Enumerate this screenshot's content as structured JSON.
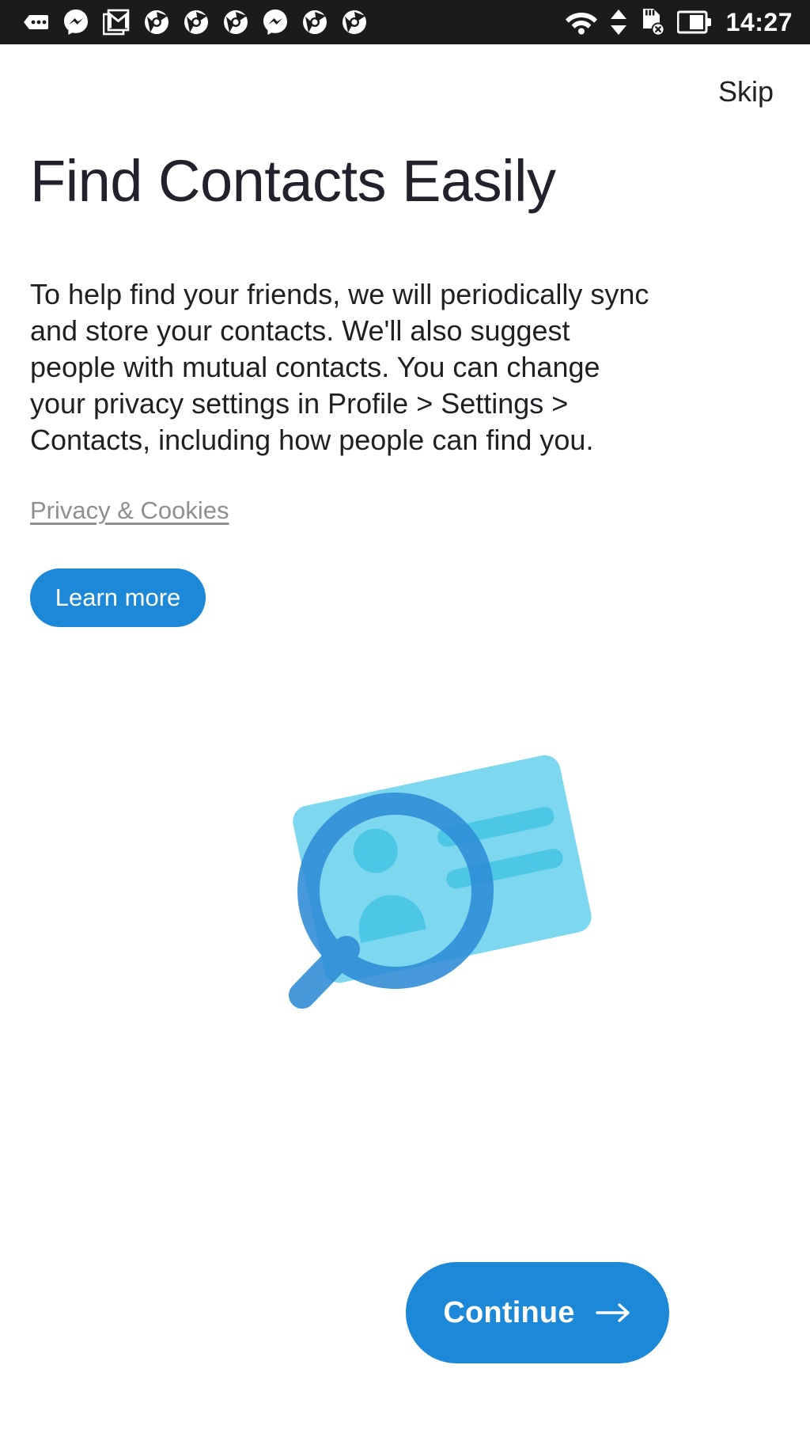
{
  "statusbar": {
    "time": "14:27",
    "left_icons": [
      {
        "name": "messages-more-icon",
        "label": "messages"
      },
      {
        "name": "messenger-icon",
        "label": "messenger"
      },
      {
        "name": "gmail-stacked-icon",
        "label": "gmail"
      },
      {
        "name": "chrome-icon",
        "label": "chrome"
      },
      {
        "name": "chrome-icon",
        "label": "chrome"
      },
      {
        "name": "chrome-icon",
        "label": "chrome"
      },
      {
        "name": "messenger-icon",
        "label": "messenger"
      },
      {
        "name": "chrome-icon",
        "label": "chrome"
      },
      {
        "name": "chrome-icon",
        "label": "chrome"
      }
    ],
    "right_icons": [
      {
        "name": "wifi-icon",
        "label": "wifi"
      },
      {
        "name": "data-transfer-icon",
        "label": "data up down"
      },
      {
        "name": "sd-card-removed-icon",
        "label": "sd card removed"
      },
      {
        "name": "battery-icon",
        "label": "battery"
      }
    ]
  },
  "screen": {
    "skip_label": "Skip",
    "title": "Find Contacts Easily",
    "body": "To help find your friends, we will periodically sync and store your contacts. We'll also suggest people with mutual contacts. You can change your privacy settings in Profile > Settings > Contacts, including how people can find you.",
    "privacy_link_label": "Privacy & Cookies",
    "learn_more_label": "Learn more",
    "continue_label": "Continue",
    "continue_arrow_glyph": "arrow-right-icon",
    "illustration_name": "contact-card-magnifier-illustration"
  },
  "colors": {
    "accent_blue": "#1e88d8",
    "illustration_card": "#7dd8ef",
    "illustration_card_detail": "#4cc8e6",
    "illustration_lens": "#2e8bd6",
    "statusbar_bg": "#1b1b1b",
    "text_primary": "#1f2023",
    "link_gray": "#8e8e93"
  }
}
